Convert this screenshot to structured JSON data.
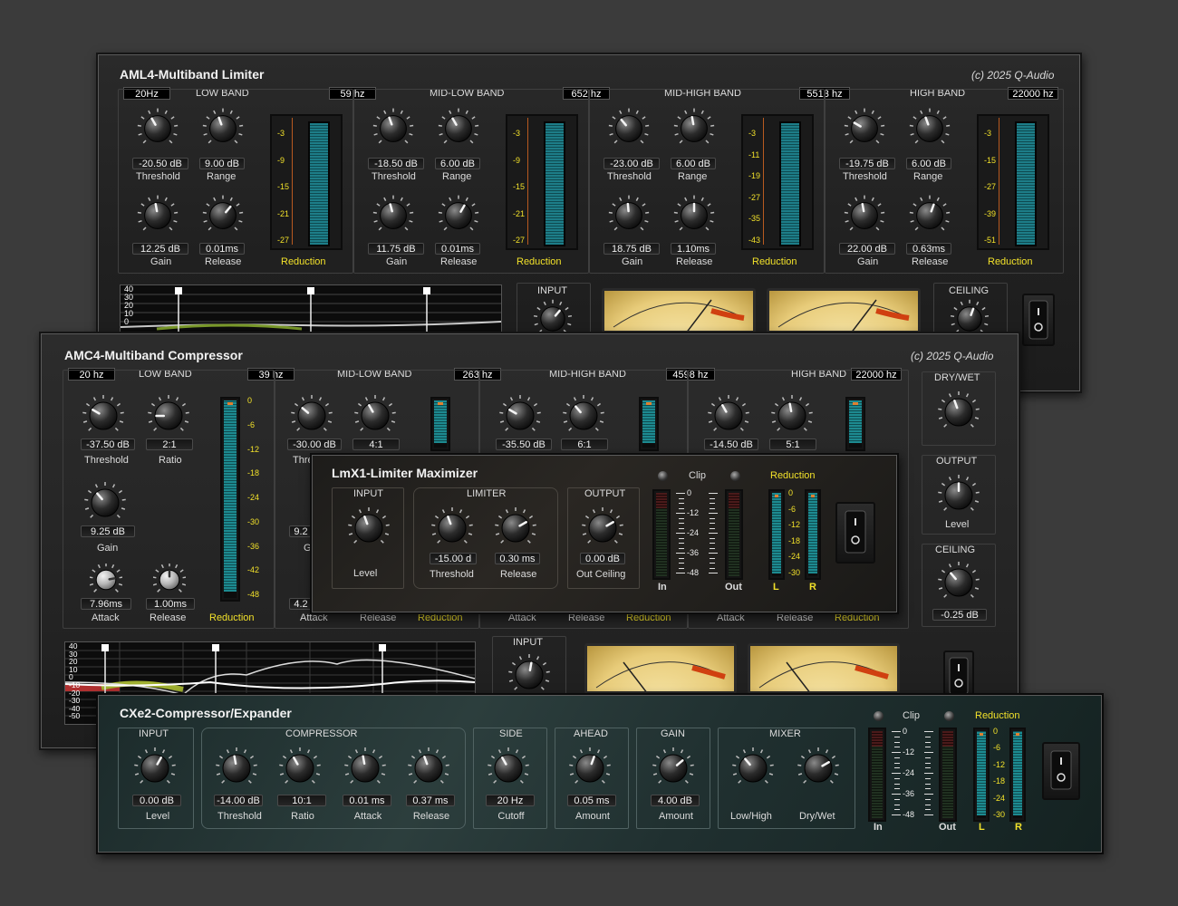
{
  "aml4": {
    "title": "AML4-Multiband Limiter",
    "copyright": "(c) 2025 Q-Audio",
    "freqs": [
      "20Hz",
      "59 hz",
      "652 hz",
      "5513 hz",
      "22000 hz"
    ],
    "bands": [
      {
        "name": "LOW BAND",
        "threshold": "-20.50 dB",
        "range": "9.00 dB",
        "gain": "12.25 dB",
        "release": "0.01ms",
        "scale": [
          "-3",
          "-9",
          "-15",
          "-21",
          "-27"
        ]
      },
      {
        "name": "MID-LOW BAND",
        "threshold": "-18.50 dB",
        "range": "6.00 dB",
        "gain": "11.75 dB",
        "release": "0.01ms",
        "scale": [
          "-3",
          "-9",
          "-15",
          "-21",
          "-27"
        ]
      },
      {
        "name": "MID-HIGH BAND",
        "threshold": "-23.00 dB",
        "range": "6.00 dB",
        "gain": "18.75 dB",
        "release": "1.10ms",
        "scale": [
          "-3",
          "-11",
          "-19",
          "-27",
          "-35",
          "-43"
        ]
      },
      {
        "name": "HIGH BAND",
        "threshold": "-19.75 dB",
        "range": "6.00 dB",
        "gain": "22.00 dB",
        "release": "0.63ms",
        "scale": [
          "-3",
          "-15",
          "-27",
          "-39",
          "-51"
        ]
      }
    ],
    "labels": {
      "threshold": "Threshold",
      "range": "Range",
      "gain": "Gain",
      "release": "Release",
      "reduction": "Reduction"
    },
    "graph_axis": [
      "40",
      "30",
      "20",
      "10",
      "0"
    ],
    "input_label": "INPUT",
    "ceiling_label": "CEILING"
  },
  "amc4": {
    "title": "AMC4-Multiband Compressor",
    "copyright": "(c) 2025 Q-Audio",
    "freqs": [
      "20 hz",
      "39 hz",
      "263 hz",
      "4598 hz",
      "22000 hz"
    ],
    "band_names": [
      "LOW BAND",
      "MID-LOW BAND",
      "MID-HIGH BAND",
      "HIGH BAND"
    ],
    "low": {
      "threshold": "-37.50 dB",
      "ratio": "2:1",
      "gain": "9.25 dB",
      "attack": "7.96ms",
      "release": "1.00ms"
    },
    "visible_values": {
      "midlow_threshold": "-30.00 dB",
      "midlow_ratio": "4:1",
      "midhigh_threshold": "-35.50 dB",
      "midhigh_ratio": "6:1",
      "high_threshold": "-14.50 dB",
      "high_ratio": "5:1",
      "midlow_gain_partial": "9.2",
      "midlow_attack_partial": "4.2"
    },
    "labels": {
      "threshold": "Threshold",
      "ratio": "Ratio",
      "gain": "Gain",
      "attack": "Attack",
      "release": "Release",
      "reduction": "Reduction",
      "threshold_partial": "Thre",
      "gain_partial": "G"
    },
    "meter_scale": [
      "0",
      "-6",
      "-12",
      "-18",
      "-24",
      "-30",
      "-36",
      "-42",
      "-48"
    ],
    "drywet_label": "DRY/WET",
    "output_label": "OUTPUT",
    "level_label": "Level",
    "ceiling_label": "CEILING",
    "ceiling_value": "-0.25 dB",
    "input_label": "INPUT",
    "graph_axis": [
      "40",
      "30",
      "20",
      "10",
      "0",
      "-10",
      "-20",
      "-30",
      "-40",
      "-50"
    ]
  },
  "lmx1": {
    "title": "LmX1-Limiter Maximizer",
    "input_label": "INPUT",
    "limiter_label": "LIMITER",
    "output_label": "OUTPUT",
    "level_label": "Level",
    "threshold_value": "-15.00 d",
    "threshold_label": "Threshold",
    "release_value": "0.30 ms",
    "release_label": "Release",
    "ceiling_value": "0.00 dB",
    "ceiling_label": "Out Ceiling",
    "clip_label": "Clip",
    "reduction_label": "Reduction",
    "in_label": "In",
    "out_label": "Out",
    "l_label": "L",
    "r_label": "R",
    "io_scale": [
      "0",
      "-12",
      "-24",
      "-36",
      "-48"
    ],
    "red_scale": [
      "0",
      "-6",
      "-12",
      "-18",
      "-24",
      "-30"
    ]
  },
  "cxe2": {
    "title": "CXe2-Compressor/Expander",
    "sections": {
      "input": "INPUT",
      "compressor": "COMPRESSOR",
      "side": "SIDE",
      "ahead": "AHEAD",
      "gain": "GAIN",
      "mixer": "MIXER"
    },
    "knobs": [
      {
        "value": "0.00 dB",
        "label": "Level"
      },
      {
        "value": "-14.00 dB",
        "label": "Threshold"
      },
      {
        "value": "10:1",
        "label": "Ratio"
      },
      {
        "value": "0.01 ms",
        "label": "Attack"
      },
      {
        "value": "0.37 ms",
        "label": "Release"
      },
      {
        "value": "20 Hz",
        "label": "Cutoff"
      },
      {
        "value": "0.05 ms",
        "label": "Amount"
      },
      {
        "value": "4.00 dB",
        "label": "Amount"
      }
    ],
    "mixer_labels": [
      "Low/High",
      "Dry/Wet"
    ],
    "clip_label": "Clip",
    "reduction_label": "Reduction",
    "in_label": "In",
    "out_label": "Out",
    "l_label": "L",
    "r_label": "R",
    "io_scale": [
      "0",
      "-12",
      "-24",
      "-36",
      "-48"
    ],
    "red_scale": [
      "0",
      "-6",
      "-12",
      "-18",
      "-24",
      "-30"
    ]
  }
}
